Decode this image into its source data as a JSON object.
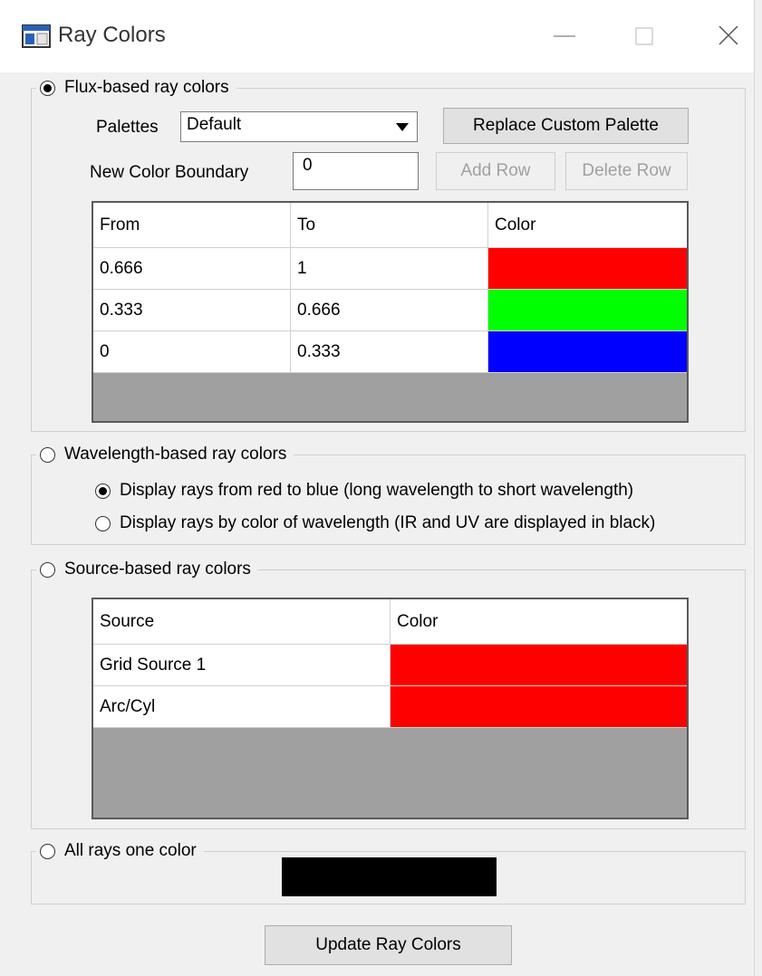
{
  "window": {
    "title": "Ray Colors",
    "icon": "app-window-icon"
  },
  "flux": {
    "label": "Flux-based ray colors",
    "selected": true,
    "palettes_label": "Palettes",
    "palette_value": "Default",
    "replace_button": "Replace Custom Palette",
    "new_boundary_label": "New Color Boundary",
    "new_boundary_value": "0",
    "add_row_button": "Add Row",
    "delete_row_button": "Delete Row",
    "columns": [
      "From",
      "To",
      "Color"
    ],
    "rows": [
      {
        "from": "0.666",
        "to": "1",
        "color": "#ff0000"
      },
      {
        "from": "0.333",
        "to": "0.666",
        "color": "#00ff00"
      },
      {
        "from": "0",
        "to": "0.333",
        "color": "#0000ff"
      }
    ]
  },
  "wavelength": {
    "label": "Wavelength-based ray colors",
    "selected": false,
    "option_red_blue": "Display rays from red to blue (long wavelength to short wavelength)",
    "option_red_blue_selected": true,
    "option_color_of_wavelength": "Display rays by color of wavelength (IR and UV are displayed in black)",
    "option_color_of_wavelength_selected": false
  },
  "source": {
    "label": "Source-based ray colors",
    "selected": false,
    "columns": [
      "Source",
      "Color"
    ],
    "rows": [
      {
        "source": "Grid Source 1",
        "color": "#ff0000"
      },
      {
        "source": "Arc/Cyl",
        "color": "#ff0000"
      }
    ]
  },
  "one_color": {
    "label": "All rays one color",
    "selected": false,
    "color": "#000000"
  },
  "update_button": "Update Ray Colors"
}
